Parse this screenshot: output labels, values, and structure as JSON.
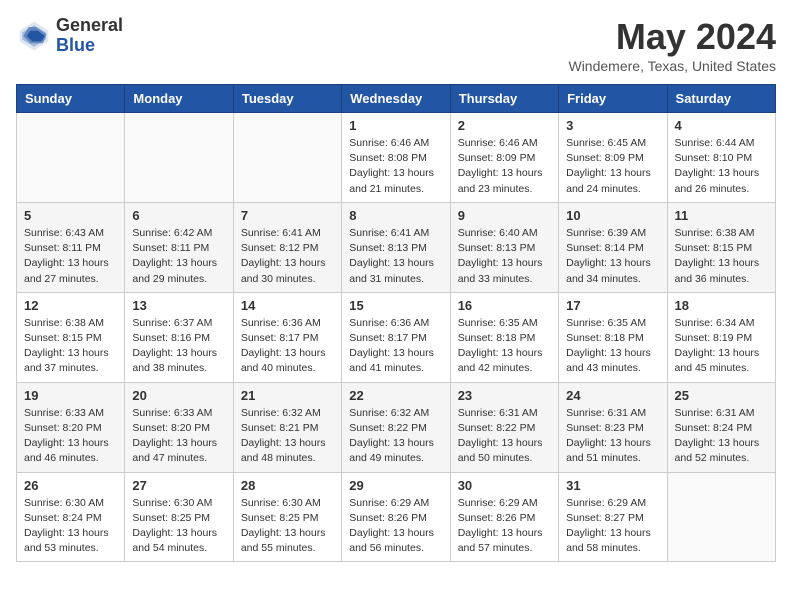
{
  "header": {
    "logo_general": "General",
    "logo_blue": "Blue",
    "month_title": "May 2024",
    "location": "Windemere, Texas, United States"
  },
  "days_of_week": [
    "Sunday",
    "Monday",
    "Tuesday",
    "Wednesday",
    "Thursday",
    "Friday",
    "Saturday"
  ],
  "weeks": [
    [
      {
        "day": "",
        "detail": ""
      },
      {
        "day": "",
        "detail": ""
      },
      {
        "day": "",
        "detail": ""
      },
      {
        "day": "1",
        "detail": "Sunrise: 6:46 AM\nSunset: 8:08 PM\nDaylight: 13 hours\nand 21 minutes."
      },
      {
        "day": "2",
        "detail": "Sunrise: 6:46 AM\nSunset: 8:09 PM\nDaylight: 13 hours\nand 23 minutes."
      },
      {
        "day": "3",
        "detail": "Sunrise: 6:45 AM\nSunset: 8:09 PM\nDaylight: 13 hours\nand 24 minutes."
      },
      {
        "day": "4",
        "detail": "Sunrise: 6:44 AM\nSunset: 8:10 PM\nDaylight: 13 hours\nand 26 minutes."
      }
    ],
    [
      {
        "day": "5",
        "detail": "Sunrise: 6:43 AM\nSunset: 8:11 PM\nDaylight: 13 hours\nand 27 minutes."
      },
      {
        "day": "6",
        "detail": "Sunrise: 6:42 AM\nSunset: 8:11 PM\nDaylight: 13 hours\nand 29 minutes."
      },
      {
        "day": "7",
        "detail": "Sunrise: 6:41 AM\nSunset: 8:12 PM\nDaylight: 13 hours\nand 30 minutes."
      },
      {
        "day": "8",
        "detail": "Sunrise: 6:41 AM\nSunset: 8:13 PM\nDaylight: 13 hours\nand 31 minutes."
      },
      {
        "day": "9",
        "detail": "Sunrise: 6:40 AM\nSunset: 8:13 PM\nDaylight: 13 hours\nand 33 minutes."
      },
      {
        "day": "10",
        "detail": "Sunrise: 6:39 AM\nSunset: 8:14 PM\nDaylight: 13 hours\nand 34 minutes."
      },
      {
        "day": "11",
        "detail": "Sunrise: 6:38 AM\nSunset: 8:15 PM\nDaylight: 13 hours\nand 36 minutes."
      }
    ],
    [
      {
        "day": "12",
        "detail": "Sunrise: 6:38 AM\nSunset: 8:15 PM\nDaylight: 13 hours\nand 37 minutes."
      },
      {
        "day": "13",
        "detail": "Sunrise: 6:37 AM\nSunset: 8:16 PM\nDaylight: 13 hours\nand 38 minutes."
      },
      {
        "day": "14",
        "detail": "Sunrise: 6:36 AM\nSunset: 8:17 PM\nDaylight: 13 hours\nand 40 minutes."
      },
      {
        "day": "15",
        "detail": "Sunrise: 6:36 AM\nSunset: 8:17 PM\nDaylight: 13 hours\nand 41 minutes."
      },
      {
        "day": "16",
        "detail": "Sunrise: 6:35 AM\nSunset: 8:18 PM\nDaylight: 13 hours\nand 42 minutes."
      },
      {
        "day": "17",
        "detail": "Sunrise: 6:35 AM\nSunset: 8:18 PM\nDaylight: 13 hours\nand 43 minutes."
      },
      {
        "day": "18",
        "detail": "Sunrise: 6:34 AM\nSunset: 8:19 PM\nDaylight: 13 hours\nand 45 minutes."
      }
    ],
    [
      {
        "day": "19",
        "detail": "Sunrise: 6:33 AM\nSunset: 8:20 PM\nDaylight: 13 hours\nand 46 minutes."
      },
      {
        "day": "20",
        "detail": "Sunrise: 6:33 AM\nSunset: 8:20 PM\nDaylight: 13 hours\nand 47 minutes."
      },
      {
        "day": "21",
        "detail": "Sunrise: 6:32 AM\nSunset: 8:21 PM\nDaylight: 13 hours\nand 48 minutes."
      },
      {
        "day": "22",
        "detail": "Sunrise: 6:32 AM\nSunset: 8:22 PM\nDaylight: 13 hours\nand 49 minutes."
      },
      {
        "day": "23",
        "detail": "Sunrise: 6:31 AM\nSunset: 8:22 PM\nDaylight: 13 hours\nand 50 minutes."
      },
      {
        "day": "24",
        "detail": "Sunrise: 6:31 AM\nSunset: 8:23 PM\nDaylight: 13 hours\nand 51 minutes."
      },
      {
        "day": "25",
        "detail": "Sunrise: 6:31 AM\nSunset: 8:24 PM\nDaylight: 13 hours\nand 52 minutes."
      }
    ],
    [
      {
        "day": "26",
        "detail": "Sunrise: 6:30 AM\nSunset: 8:24 PM\nDaylight: 13 hours\nand 53 minutes."
      },
      {
        "day": "27",
        "detail": "Sunrise: 6:30 AM\nSunset: 8:25 PM\nDaylight: 13 hours\nand 54 minutes."
      },
      {
        "day": "28",
        "detail": "Sunrise: 6:30 AM\nSunset: 8:25 PM\nDaylight: 13 hours\nand 55 minutes."
      },
      {
        "day": "29",
        "detail": "Sunrise: 6:29 AM\nSunset: 8:26 PM\nDaylight: 13 hours\nand 56 minutes."
      },
      {
        "day": "30",
        "detail": "Sunrise: 6:29 AM\nSunset: 8:26 PM\nDaylight: 13 hours\nand 57 minutes."
      },
      {
        "day": "31",
        "detail": "Sunrise: 6:29 AM\nSunset: 8:27 PM\nDaylight: 13 hours\nand 58 minutes."
      },
      {
        "day": "",
        "detail": ""
      }
    ]
  ]
}
